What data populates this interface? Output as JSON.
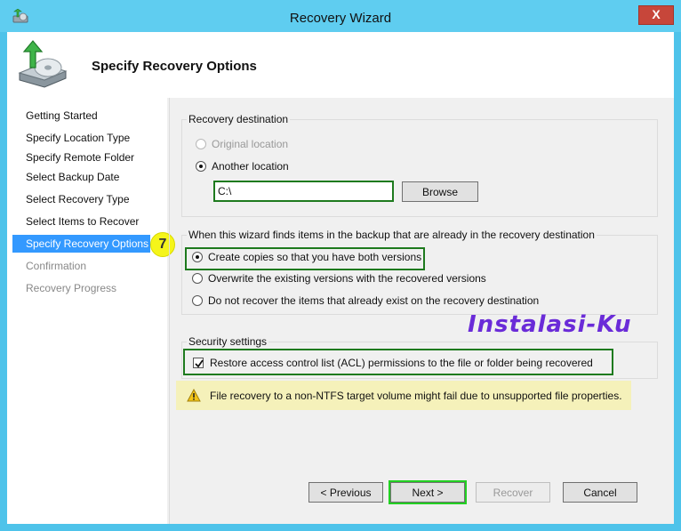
{
  "window": {
    "title": "Recovery Wizard",
    "close_label": "X"
  },
  "header": {
    "title": "Specify Recovery Options"
  },
  "nav": {
    "items": [
      {
        "label": "Getting Started",
        "state": "normal"
      },
      {
        "label": "Specify Location Type",
        "state": "normal"
      },
      {
        "label": "Specify Remote Folder",
        "state": "normal"
      },
      {
        "label": "Select Backup Date",
        "state": "normal"
      },
      {
        "label": "Select Recovery Type",
        "state": "normal"
      },
      {
        "label": "Select Items to Recover",
        "state": "normal"
      },
      {
        "label": "Specify Recovery Options",
        "state": "active"
      },
      {
        "label": "Confirmation",
        "state": "disabled"
      },
      {
        "label": "Recovery Progress",
        "state": "disabled"
      }
    ],
    "step_badge": "7"
  },
  "destination": {
    "group_label": "Recovery destination",
    "original_label": "Original location",
    "another_label": "Another location",
    "path_value": "C:\\",
    "browse_label": "Browse"
  },
  "conflict": {
    "group_label": "When this wizard finds items in the backup that are already in the recovery destination",
    "option_copies": "Create copies so that you have both versions",
    "option_overwrite": "Overwrite the existing versions with the recovered versions",
    "option_skip": "Do not recover the items that already exist on the recovery destination"
  },
  "security": {
    "group_label": "Security settings",
    "acl_label": "Restore access control list (ACL) permissions to the file or folder being recovered"
  },
  "warning": {
    "text": "File recovery to a non-NTFS target volume might fail due to unsupported file properties."
  },
  "watermark": "Instalasi-Ku",
  "buttons": {
    "previous": "< Previous",
    "next": "Next >",
    "recover": "Recover",
    "cancel": "Cancel"
  },
  "colors": {
    "title_bar": "#5fcdf0",
    "highlight_green": "#1e7a1e",
    "next_highlight": "#22d022",
    "nav_active": "#3399ff",
    "warning_bg": "#f5f1ba",
    "watermark": "#6a2bd8"
  }
}
